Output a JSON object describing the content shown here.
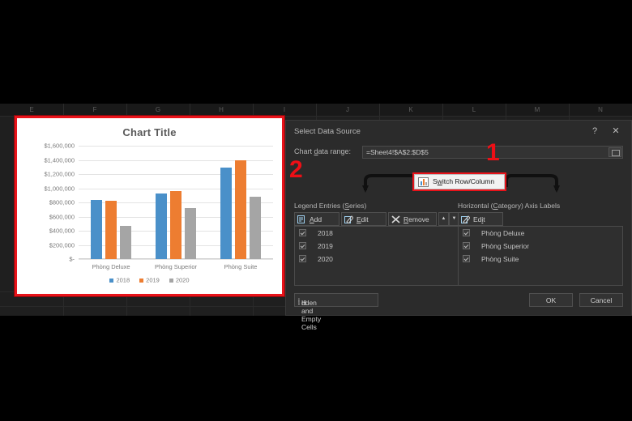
{
  "spreadsheet": {
    "column_headers": [
      "E",
      "F",
      "G",
      "H",
      "I",
      "J",
      "K",
      "L",
      "M",
      "N"
    ]
  },
  "chart": {
    "title": "Chart Title",
    "selected": true,
    "selection_color": "#e8131a"
  },
  "chart_data": {
    "type": "bar",
    "title": "Chart Title",
    "categories": [
      "Phòng Deluxe",
      "Phòng Superior",
      "Phòng Suite"
    ],
    "series": [
      {
        "name": "2018",
        "color": "#4a90c9",
        "values": [
          840000,
          930000,
          1290000
        ]
      },
      {
        "name": "2019",
        "color": "#ed7d31",
        "values": [
          820000,
          960000,
          1400000
        ]
      },
      {
        "name": "2020",
        "color": "#a5a5a5",
        "values": [
          470000,
          720000,
          880000
        ]
      }
    ],
    "ylim": [
      0,
      1600000
    ],
    "ytick_labels": [
      "$1,600,000",
      "$1,400,000",
      "$1,200,000",
      "$1,000,000",
      "$800,000",
      "$600,000",
      "$400,000",
      "$200,000",
      "$-"
    ],
    "ytick_values": [
      1600000,
      1400000,
      1200000,
      1000000,
      800000,
      600000,
      400000,
      200000,
      0
    ],
    "xlabel": "",
    "ylabel": "",
    "grid": true,
    "legend_position": "bottom"
  },
  "dialog": {
    "title": "Select Data Source",
    "help_icon": "?",
    "close_icon": "✕",
    "range_label_pre": "Chart ",
    "range_label_accel": "d",
    "range_label_post": "ata range:",
    "range_value": "=Sheet4!$A$2:$D$5",
    "range_picker_icon": "range-picker-icon",
    "switch_button": {
      "label_pre": "S",
      "label_accel": "w",
      "label_post": "itch Row/Column",
      "icon": "switch-row-column-icon",
      "highlighted": true
    },
    "legend_panel": {
      "header_pre": "Legend Entries (",
      "header_accel": "S",
      "header_post": "eries)",
      "add": {
        "pre": "",
        "accel": "A",
        "post": "dd",
        "icon": "add-icon"
      },
      "edit": {
        "pre": "",
        "accel": "E",
        "post": "dit",
        "icon": "edit-icon"
      },
      "remove": {
        "pre": "",
        "accel": "R",
        "post": "emove",
        "icon": "remove-icon"
      },
      "move_up_icon": "▲",
      "move_down_icon": "▼",
      "items": [
        {
          "label": "2018",
          "checked": true
        },
        {
          "label": "2019",
          "checked": true
        },
        {
          "label": "2020",
          "checked": true
        }
      ]
    },
    "axis_panel": {
      "header_pre": "Horizontal (",
      "header_accel": "C",
      "header_post": "ategory) Axis Labels",
      "edit": {
        "pre": "Ed",
        "accel": "i",
        "post": "t",
        "icon": "edit-icon"
      },
      "items": [
        {
          "label": "Phòng Deluxe",
          "checked": true
        },
        {
          "label": "Phòng Superior",
          "checked": true
        },
        {
          "label": "Phòng Suite",
          "checked": true
        }
      ]
    },
    "hidden_cells": {
      "pre": "H",
      "accel": "i",
      "post": "dden and Empty Cells"
    },
    "ok_label": "OK",
    "cancel_label": "Cancel"
  },
  "annotations": [
    {
      "id": "1",
      "text": "1",
      "color": "#ee0f16"
    },
    {
      "id": "2",
      "text": "2",
      "color": "#ee0f16"
    }
  ]
}
